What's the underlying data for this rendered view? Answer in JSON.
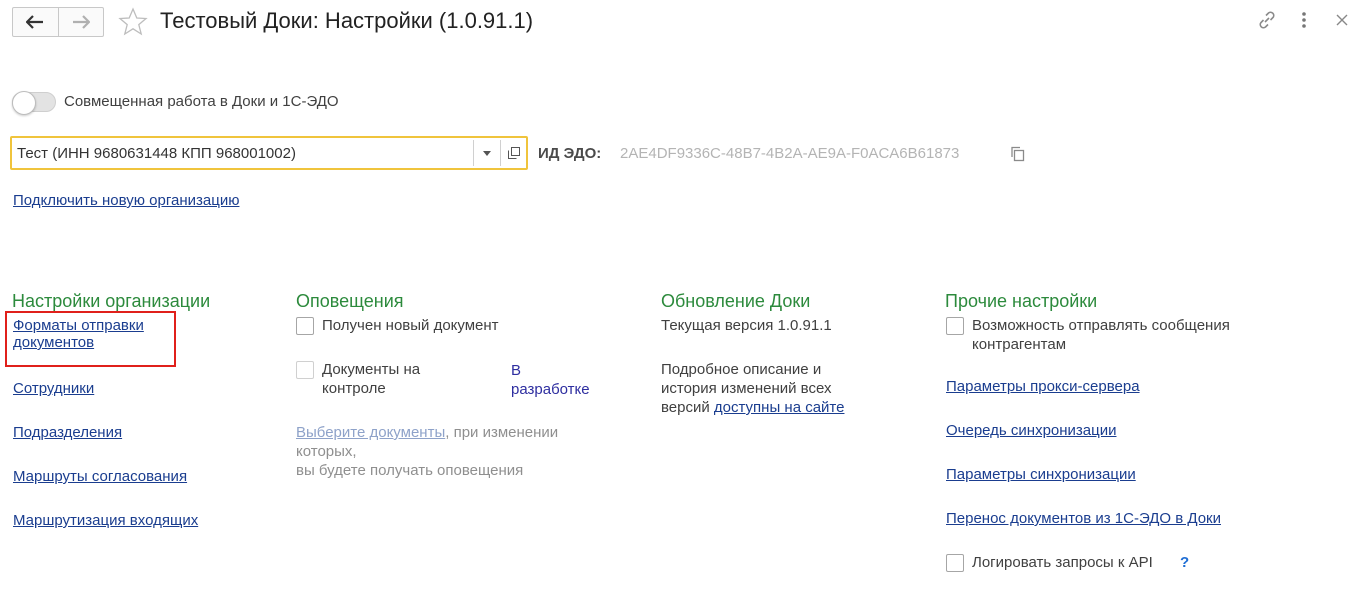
{
  "header": {
    "title": "Тестовый Доки: Настройки (1.0.91.1)"
  },
  "combined_work": {
    "label": "Совмещенная работа в Доки и 1С-ЭДО",
    "enabled": false
  },
  "organization": {
    "selected": "Тест (ИНН 9680631448 КПП 968001002)",
    "edo_id_label": "ИД ЭДО:",
    "edo_id_value": "2AE4DF9336C-48B7-4B2A-AE9A-F0ACA6B61873",
    "connect_link": "Подключить новую организацию"
  },
  "org_settings": {
    "heading": "Настройки организации",
    "links": {
      "formats_line1": "Форматы отправки",
      "formats_line2": "документов",
      "employees": "Сотрудники",
      "departments": "Подразделения",
      "approval_routes": "Маршруты согласования",
      "incoming_routing": "Маршрутизация входящих"
    }
  },
  "notifications": {
    "heading": "Оповещения",
    "new_document": "Получен новый документ",
    "on_control_line1": "Документы на",
    "on_control_line2": "контроле",
    "in_dev_line1": "В",
    "in_dev_line2": "разработке",
    "choose_docs_link": "Выберите документы",
    "choose_docs_rest1": ", при изменении",
    "choose_docs_rest2": "которых,",
    "choose_docs_rest3": "вы будете получать оповещения"
  },
  "update": {
    "heading": "Обновление Доки",
    "current_version": "Текущая версия 1.0.91.1",
    "desc_line1": "Подробное описание и",
    "desc_line2": "история изменений всех",
    "desc_line3": "версий",
    "site_link": "доступны на сайте"
  },
  "other": {
    "heading": "Прочие настройки",
    "send_messages_line1": "Возможность отправлять сообщения",
    "send_messages_line2": "контрагентам",
    "proxy_link": "Параметры прокси-сервера",
    "sync_queue_link": "Очередь синхронизации",
    "sync_params_link": "Параметры синхронизации",
    "transfer_link": "Перенос документов из 1С-ЭДО в Доки",
    "log_api": "Логировать запросы к API",
    "help": "?"
  },
  "colors": {
    "section_heading": "#2c8a3c",
    "link": "#1a3d8f",
    "highlight": "#e0201b",
    "focus_border": "#f0c43c"
  }
}
